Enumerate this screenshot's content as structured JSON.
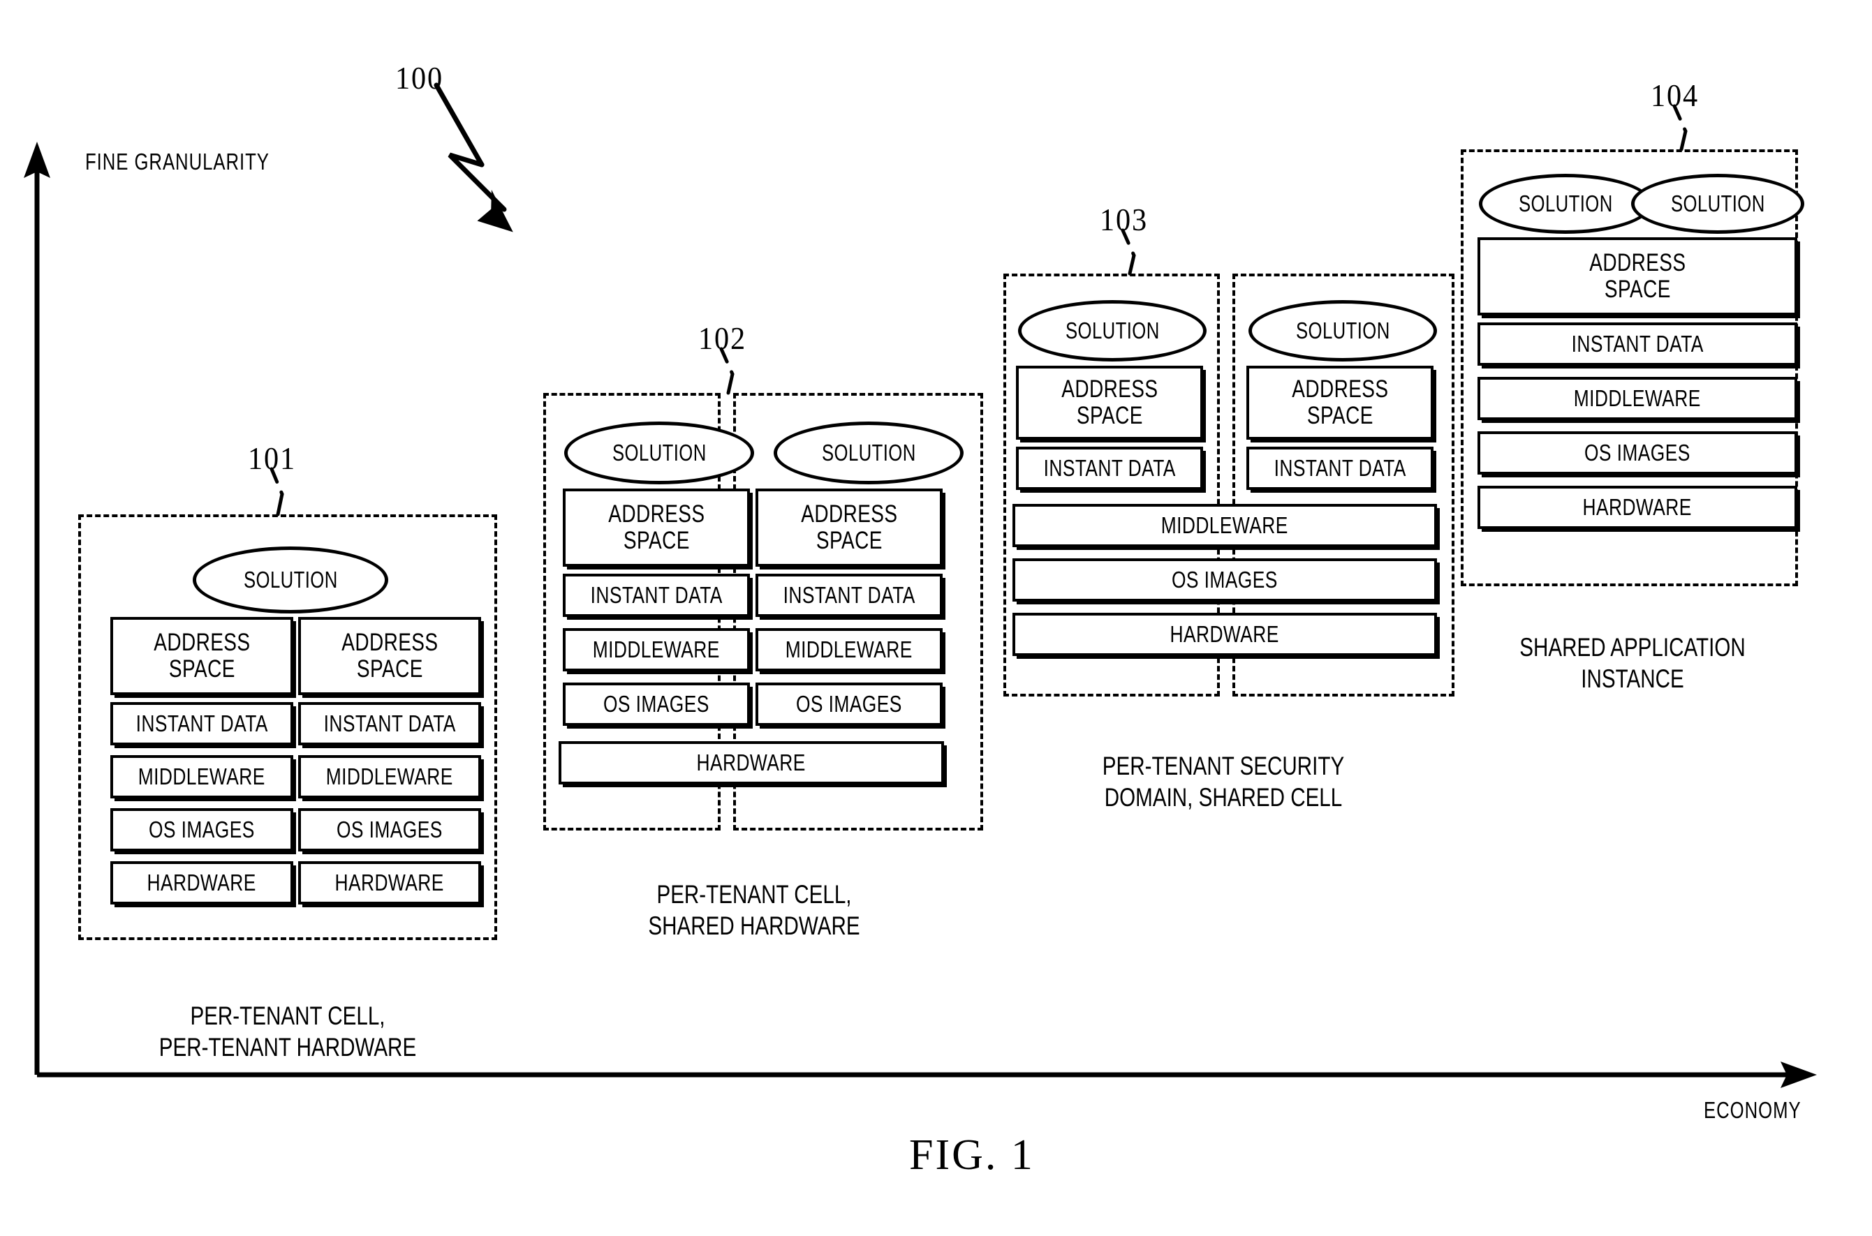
{
  "figure": {
    "title": "FIG. 1",
    "diagram_ref": "100"
  },
  "axes": {
    "y_label": "FINE GRANULARITY",
    "x_label": "ECONOMY"
  },
  "layers": {
    "solution": "SOLUTION",
    "address_space": "ADDRESS\nSPACE",
    "instant_data": "INSTANT DATA",
    "middleware": "MIDDLEWARE",
    "os_images": "OS IMAGES",
    "hardware": "HARDWARE"
  },
  "groups": [
    {
      "ref": "101",
      "caption": "PER-TENANT CELL,\nPER-TENANT HARDWARE",
      "tenants": 2,
      "shared_from": null,
      "solutions": 1,
      "solutions_shared": true
    },
    {
      "ref": "102",
      "caption": "PER-TENANT CELL,\nSHARED HARDWARE",
      "tenants": 2,
      "shared_from": "hardware",
      "solutions": 2,
      "solutions_shared": false
    },
    {
      "ref": "103",
      "caption": "PER-TENANT SECURITY\nDOMAIN, SHARED CELL",
      "tenants": 2,
      "shared_from": "middleware",
      "solutions": 2,
      "solutions_shared": false
    },
    {
      "ref": "104",
      "caption": "SHARED APPLICATION\nINSTANCE",
      "tenants": 1,
      "shared_from": "address_space",
      "solutions": 2,
      "solutions_shared": false
    }
  ]
}
